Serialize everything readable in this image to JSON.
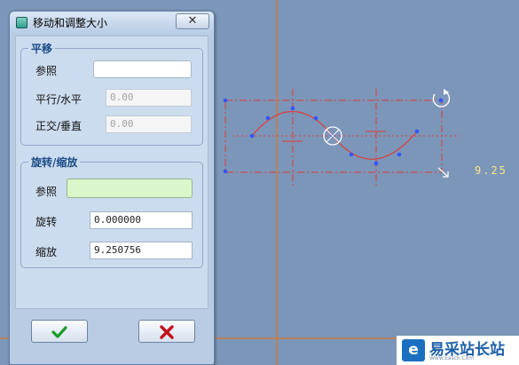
{
  "dialog": {
    "title": "移动和调整大小",
    "close_label": "✕",
    "translate_group": {
      "title": "平移",
      "reference_label": "参照",
      "reference_value": "",
      "horizontal_label": "平行/水平",
      "horizontal_value": "0.00",
      "vertical_label": "正交/垂直",
      "vertical_value": "0.00"
    },
    "rotate_group": {
      "title": "旋转/缩放",
      "reference_label": "参照",
      "reference_value": "",
      "rotate_label": "旋转",
      "rotate_value": "0.000000",
      "scale_label": "缩放",
      "scale_value": "9.250756"
    },
    "ok_icon": "check-icon",
    "cancel_icon": "cross-icon"
  },
  "canvas": {
    "scale_readout": "9.25"
  },
  "watermark": {
    "text": "易采站长站",
    "subtext": "Www.Easck.Com"
  },
  "colors": {
    "background": "#7b96b8",
    "sketch_line": "#e23a3a",
    "handle": "#3355ff",
    "axis": "#d9782a"
  }
}
